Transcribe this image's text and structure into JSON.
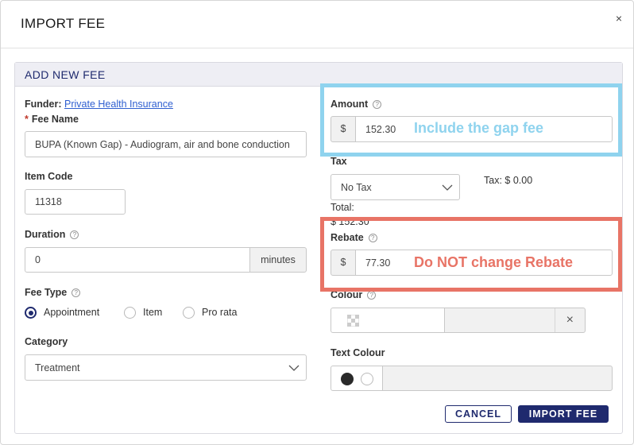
{
  "modal": {
    "title": "IMPORT FEE",
    "close_label": "×"
  },
  "panel": {
    "title": "ADD NEW FEE"
  },
  "funder": {
    "label": "Funder:",
    "value": "Private Health Insurance"
  },
  "fee_name": {
    "required_mark": "*",
    "label": "Fee Name",
    "value": "BUPA (Known Gap) - Audiogram, air and bone conduction"
  },
  "item_code": {
    "label": "Item Code",
    "value": "11318"
  },
  "duration": {
    "label": "Duration",
    "value": "0",
    "unit": "minutes"
  },
  "fee_type": {
    "label": "Fee Type",
    "options": [
      {
        "label": "Appointment",
        "selected": true
      },
      {
        "label": "Item",
        "selected": false
      },
      {
        "label": "Pro rata",
        "selected": false
      }
    ]
  },
  "category": {
    "label": "Category",
    "value": "Treatment"
  },
  "amount": {
    "label": "Amount",
    "currency": "$",
    "value": "152.30"
  },
  "tax": {
    "label": "Tax",
    "value": "No Tax",
    "summary": "Tax: $ 0.00",
    "total_label": "Total:",
    "total_value": "$ 152.30"
  },
  "rebate": {
    "label": "Rebate",
    "currency": "$",
    "value": "77.30"
  },
  "colour": {
    "label": "Colour",
    "clear_label": "×"
  },
  "text_colour": {
    "label": "Text Colour"
  },
  "annotations": {
    "amount_note": "Include the gap fee",
    "rebate_note": "Do NOT change Rebate",
    "amount_color": "#8fd3ee",
    "rebate_color": "#e87466"
  },
  "buttons": {
    "cancel": "CANCEL",
    "import": "IMPORT FEE"
  },
  "colors": {
    "accent": "#1f2a6e",
    "link": "#2f5fd0"
  }
}
